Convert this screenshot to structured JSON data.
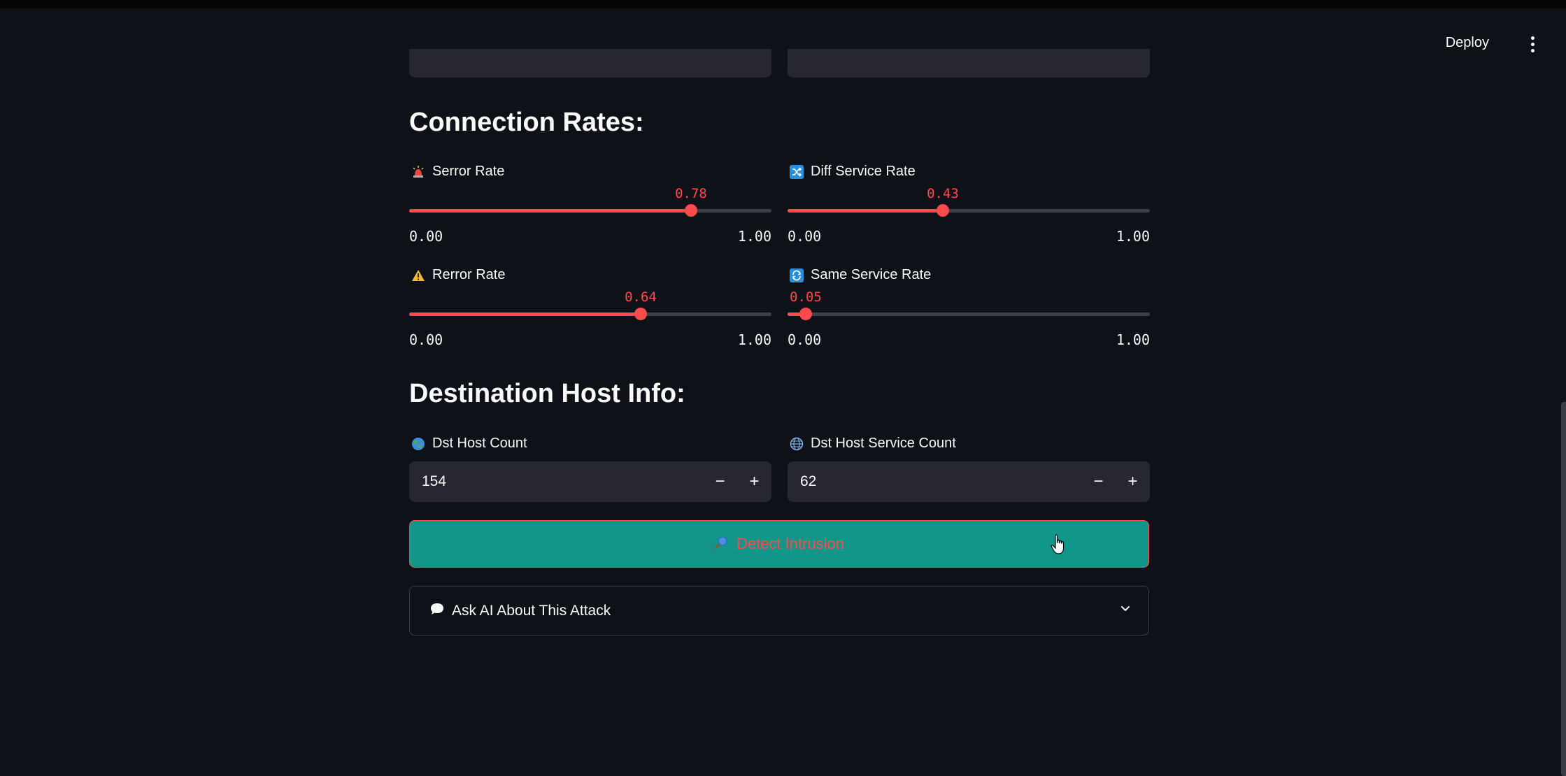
{
  "header": {
    "deploy_label": "Deploy",
    "menu_icon": "kebab-menu-icon"
  },
  "connection_rates": {
    "heading": "Connection Rates:",
    "sliders": [
      {
        "id": "serror",
        "label": "Serror Rate",
        "icon": "siren-icon",
        "value": "0.78",
        "value_num": 0.78,
        "min": "0.00",
        "max": "1.00"
      },
      {
        "id": "diff",
        "label": "Diff Service Rate",
        "icon": "shuffle-icon",
        "value": "0.43",
        "value_num": 0.43,
        "min": "0.00",
        "max": "1.00"
      },
      {
        "id": "rerror",
        "label": "Rerror Rate",
        "icon": "warning-icon",
        "value": "0.64",
        "value_num": 0.64,
        "min": "0.00",
        "max": "1.00"
      },
      {
        "id": "same",
        "label": "Same Service Rate",
        "icon": "repeat-icon",
        "value": "0.05",
        "value_num": 0.05,
        "min": "0.00",
        "max": "1.00"
      }
    ]
  },
  "destination": {
    "heading": "Destination Host Info:",
    "dst_host_count": {
      "label": "Dst Host Count",
      "icon": "globe-icon",
      "value": "154",
      "minus": "−",
      "plus": "+"
    },
    "dst_host_srv_count": {
      "label": "Dst Host Service Count",
      "icon": "globe-meridians-icon",
      "value": "62",
      "minus": "−",
      "plus": "+"
    }
  },
  "actions": {
    "detect_label": "Detect Intrusion",
    "detect_icon": "magnifier-icon",
    "ask_ai_label": "Ask AI About This Attack",
    "ask_ai_icon": "speech-bubble-icon"
  },
  "colors": {
    "background": "#0e1117",
    "accent": "#ff4b4b",
    "input_bg": "#262730",
    "button_bg": "#12968a"
  }
}
